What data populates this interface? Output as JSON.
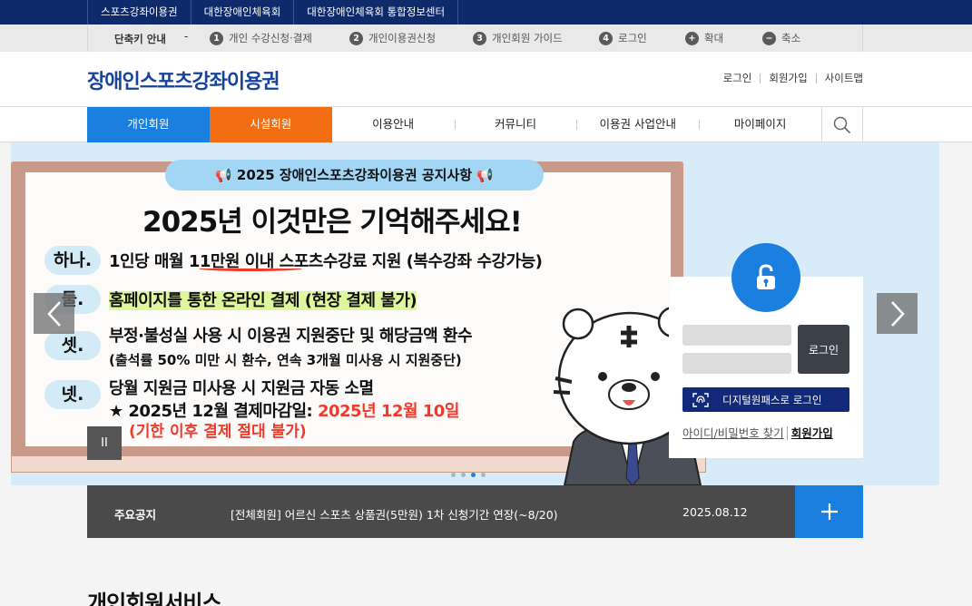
{
  "topbar": {
    "links": [
      "스포츠강좌이용권",
      "대한장애인체육회",
      "대한장애인체육회 통합정보센터"
    ]
  },
  "shortcut": {
    "title": "단축키 안내",
    "dash": "-",
    "items": [
      {
        "num": "1",
        "label": "개인 수강신청·결제"
      },
      {
        "num": "2",
        "label": "개인이용권신청"
      },
      {
        "num": "3",
        "label": "개인회원 가이드"
      },
      {
        "num": "4",
        "label": "로그인"
      },
      {
        "num": "+",
        "label": "확대"
      },
      {
        "num": "−",
        "label": "축소"
      }
    ]
  },
  "header": {
    "logo": "장애인스포츠강좌이용권",
    "util": [
      "로그인",
      "회원가입",
      "사이트맵"
    ]
  },
  "gnb": {
    "tabs": [
      "개인회원",
      "시설회원",
      "이용안내",
      "커뮤니티",
      "이용권 사업안내",
      "마이페이지"
    ],
    "search_icon": "search-icon"
  },
  "banner": {
    "pill": "2025 장애인스포츠강좌이용권 공지사항",
    "headline": "2025년 이것만은 기억해주세요!",
    "rows": [
      {
        "label": "하나.",
        "pre": "1인당 매월 ",
        "emph": "11만원 이내",
        "post": " 스포츠수강료 지원 (복수강좌 수강가능)"
      },
      {
        "label": "둘.",
        "text": "홈페이지를 통한 온라인 결제 (현장 결제 불가)"
      },
      {
        "label": "셋.",
        "text": "부정·불성실 사용 시 이용권 지원중단 및 해당금액 환수",
        "sub": "(출석률 50% 미만 시 환수, 연속 3개월 미사용 시 지원중단)"
      },
      {
        "label": "넷.",
        "text": "당월 지원금 미사용 시 지원금 자동 소멸",
        "deadline_pre": "★ 2025년 12월 결제마감일: ",
        "deadline_date": "2025년 12월 10일",
        "deadline_note": "(기한 이후 결제 절대 불가)"
      }
    ],
    "pause": "II",
    "slide_count": 4,
    "active_slide": 2
  },
  "login": {
    "button": "로그인",
    "digital": "디지털원패스로 로그인",
    "find": "아이디/비밀번호 찾기",
    "join": "회원가입"
  },
  "notice": {
    "label": "주요공지",
    "title": "[전체회원] 어르신 스포츠 상품권(5만원) 1차 신청기간 연장(~8/20)",
    "date": "2025.08.12",
    "more": "+"
  },
  "section": {
    "title": "개인회원서비스"
  },
  "colors": {
    "navy": "#0f2a6b",
    "blue": "#1b7fe0",
    "orange": "#f36d12",
    "red": "#ef3b2c"
  }
}
